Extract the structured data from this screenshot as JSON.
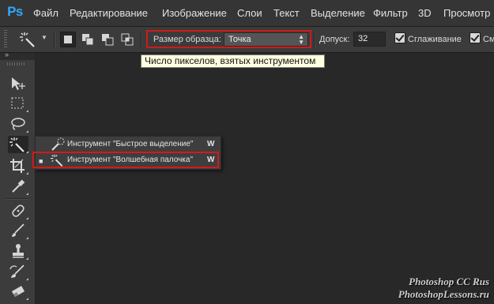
{
  "app": {
    "logo": "Ps"
  },
  "menu": [
    {
      "label": "Файл",
      "name": "menu-file"
    },
    {
      "label": "Редактирование",
      "name": "menu-edit"
    },
    {
      "label": "Изображение",
      "name": "menu-image"
    },
    {
      "label": "Слои",
      "name": "menu-layers"
    },
    {
      "label": "Текст",
      "name": "menu-type"
    },
    {
      "label": "Выделение",
      "name": "menu-select"
    },
    {
      "label": "Фильтр",
      "name": "menu-filter"
    },
    {
      "label": "3D",
      "name": "menu-3d"
    },
    {
      "label": "Просмотр",
      "name": "menu-view"
    }
  ],
  "options": {
    "sample_size_label": "Размер образца:",
    "sample_size_value": "Точка",
    "tolerance_label": "Допуск:",
    "tolerance_value": "32",
    "antialias_label": "Сглаживание",
    "contiguous_label": "См",
    "selection_modes": [
      "new-selection",
      "add-to-selection",
      "subtract-from-selection",
      "intersect-with-selection"
    ]
  },
  "tooltip": "Число пикселов, взятых инструментом",
  "tools_panel": {
    "collapse_glyph": "»"
  },
  "flyout": [
    {
      "label": "Инструмент \"Быстрое выделение\"",
      "shortcut": "W",
      "selected": false,
      "icon": "quick-selection-icon"
    },
    {
      "label": "Инструмент \"Волшебная палочка\"",
      "shortcut": "W",
      "selected": true,
      "icon": "magic-wand-icon"
    }
  ],
  "watermark": {
    "line1": "Photoshop  CC  Rus",
    "line2": "PhotoshopLessons.ru"
  },
  "colors": {
    "accent_red": "#d11a1a",
    "logo_blue": "#31a8ff",
    "tooltip_bg": "#ffffe1"
  }
}
